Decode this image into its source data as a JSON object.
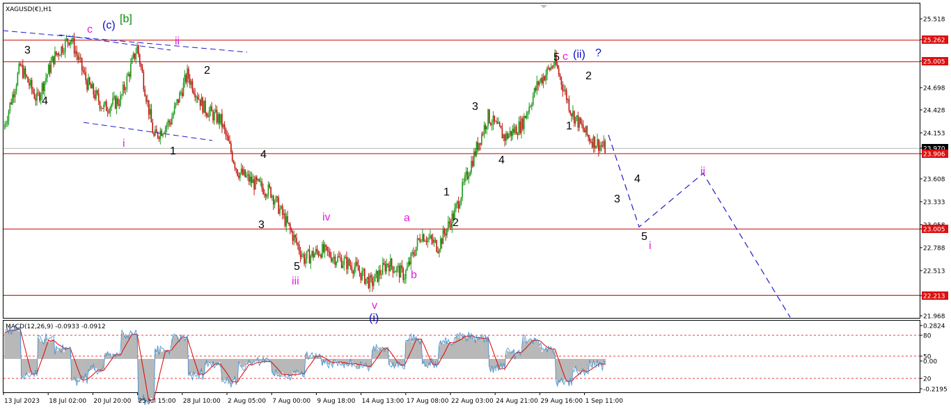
{
  "title": "XAGUSD(€),H1",
  "macd_title": "MACD(12,26,9) -0.0933 -0.0912",
  "colors": {
    "up_candle": "#1a9b1a",
    "down_candle": "#c0140c",
    "level_line": "#cc0000",
    "wave_path": "#0000cc",
    "wave_black": "#000000",
    "wave_magenta": "#e020e0",
    "wave_blue": "#0a0acc",
    "wave_green": "#0a8a0a",
    "macd_hist": "#b8b8b8",
    "macd_signal": "#dd0000",
    "macd_line": "#3b8fd6",
    "price_badge": "#dd1111"
  },
  "price_axis": {
    "ticks": [
      "25.518",
      "25.262",
      "25.005",
      "24.698",
      "24.428",
      "24.153",
      "23.970",
      "23.906",
      "23.608",
      "23.333",
      "23.058",
      "23.005",
      "22.788",
      "22.513",
      "22.213",
      "21.968"
    ],
    "badges": [
      "25.262",
      "25.005",
      "23.906",
      "23.005",
      "22.213"
    ],
    "current": "23.970"
  },
  "macd_axis": {
    "ticks": [
      "0.2824",
      "80",
      "50",
      "0.00",
      "20",
      "-0.2195"
    ]
  },
  "time_axis": {
    "labels": [
      "13 Jul 2023",
      "18 Jul 02:00",
      "20 Jul 20:00",
      "25 Jul 15:00",
      "28 Jul 10:00",
      "2 Aug 05:00",
      "7 Aug 00:00",
      "9 Aug 18:00",
      "14 Aug 13:00",
      "17 Aug 08:00",
      "22 Aug 03:00",
      "24 Aug 21:00",
      "29 Aug 16:00",
      "1 Sep 11:00"
    ]
  },
  "chart_data": {
    "type": "candlestick",
    "symbol": "XAGUSD(€),H1",
    "ylim": [
      21.968,
      25.518
    ],
    "horizontal_levels": [
      25.262,
      25.005,
      23.906,
      23.005,
      22.213
    ],
    "price_path": [
      [
        "13 Jul 2023",
        24.2
      ],
      [
        "15 Jul",
        24.95
      ],
      [
        "17 Jul",
        24.55
      ],
      [
        "18 Jul 02:00",
        25.05
      ],
      [
        "19 Jul",
        25.3
      ],
      [
        "20 Jul",
        24.75
      ],
      [
        "21 Jul",
        24.45
      ],
      [
        "24 Jul",
        24.55
      ],
      [
        "25 Jul 15:00",
        25.18
      ],
      [
        "26 Jul",
        24.1
      ],
      [
        "27 Jul",
        24.3
      ],
      [
        "28 Jul 10:00",
        24.85
      ],
      [
        "30 Jul",
        24.45
      ],
      [
        "31 Jul",
        24.3
      ],
      [
        "1 Aug",
        23.7
      ],
      [
        "2 Aug 05:00",
        23.55
      ],
      [
        "3 Aug",
        23.45
      ],
      [
        "4 Aug",
        23.05
      ],
      [
        "7 Aug 00:00",
        22.65
      ],
      [
        "8 Aug",
        22.75
      ],
      [
        "9 Aug 18:00",
        22.65
      ],
      [
        "11 Aug",
        22.55
      ],
      [
        "14 Aug 13:00",
        22.35
      ],
      [
        "15 Aug",
        22.6
      ],
      [
        "16 Aug",
        22.45
      ],
      [
        "17 Aug 08:00",
        22.95
      ],
      [
        "18 Aug",
        22.8
      ],
      [
        "21 Aug",
        23.2
      ],
      [
        "22 Aug 03:00",
        23.8
      ],
      [
        "23 Aug",
        24.35
      ],
      [
        "24 Aug 21:00",
        24.1
      ],
      [
        "28 Aug",
        24.25
      ],
      [
        "29 Aug 16:00",
        24.75
      ],
      [
        "30 Aug",
        25.0
      ],
      [
        "31 Aug",
        24.4
      ],
      [
        "1 Sep 11:00",
        24.1
      ],
      [
        "4 Sep",
        23.97
      ]
    ],
    "macd": {
      "title": "MACD(12,26,9) -0.0933 -0.0912",
      "values": {
        "main": -0.0933,
        "signal": -0.0912
      },
      "ylim": [
        -0.2195,
        0.2824
      ]
    },
    "wave_labels": [
      "3",
      "4",
      "c",
      "(c)",
      "[b]",
      "ii",
      "i",
      "1",
      "2",
      "4",
      "3",
      "5",
      "iii",
      "iv",
      "v",
      "(i)",
      "a",
      "b",
      "1",
      "2",
      "3",
      "4",
      "5",
      "c",
      "(ii)",
      "?",
      "2",
      "1",
      "3",
      "4",
      "5",
      "i",
      "ii"
    ],
    "projection": [
      [
        "1 Sep 11:00",
        24.1
      ],
      [
        "5 Sep",
        23.1
      ],
      [
        "7 Sep",
        23.65
      ],
      [
        "11 Sep",
        21.9
      ]
    ]
  }
}
